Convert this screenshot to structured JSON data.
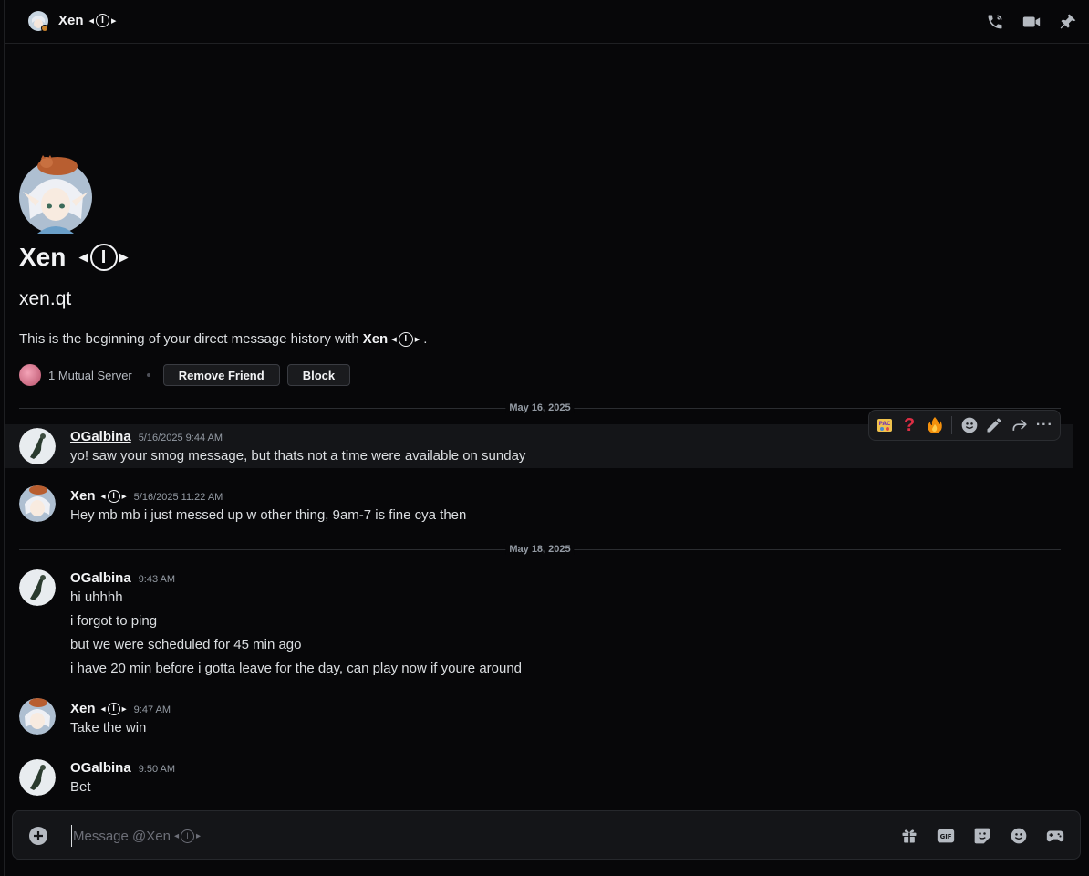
{
  "header": {
    "name": "Xen",
    "icons": [
      "phone-call-icon",
      "video-call-icon",
      "pin-icon"
    ]
  },
  "intro": {
    "display_name": "Xen",
    "username": "xen.qt",
    "description_prefix": "This is the beginning of your direct message history with",
    "description_name": "Xen",
    "description_suffix": ".",
    "mutual_servers": "1 Mutual Server",
    "remove_friend_label": "Remove Friend",
    "block_label": "Block"
  },
  "dividers": [
    "May 16, 2025",
    "May 18, 2025"
  ],
  "messages": [
    {
      "author": "OGalbina",
      "timestamp": "5/16/2025 9:44 AM",
      "lines": [
        "yo! saw your smog message, but thats not a time were available on sunday"
      ]
    },
    {
      "author": "Xen",
      "timestamp": "5/16/2025 11:22 AM",
      "lines": [
        "Hey mb mb i just messed up w other thing, 9am-7 is fine cya then"
      ]
    },
    {
      "author": "OGalbina",
      "timestamp": "9:43 AM",
      "lines": [
        "hi uhhhh",
        "i forgot to ping",
        "but we were scheduled for 45 min ago",
        "i have 20 min before i gotta leave for the day, can play now if youre around"
      ]
    },
    {
      "author": "Xen",
      "timestamp": "9:47 AM",
      "lines": [
        "Take the win"
      ]
    },
    {
      "author": "OGalbina",
      "timestamp": "9:50 AM",
      "lines": [
        "Bet"
      ]
    }
  ],
  "hover_actions": [
    "pac-emoji",
    "question-emoji",
    "fire-emoji",
    "add-reaction-icon",
    "edit-icon",
    "forward-icon",
    "more-icon"
  ],
  "composer": {
    "placeholder": "Message @Xen",
    "icons": [
      "gift-icon",
      "gif-icon",
      "sticker-icon",
      "emoji-icon",
      "activity-icon"
    ]
  },
  "colors": {
    "background": "#070709",
    "highlight": "#141518",
    "text": "#dbdee1",
    "muted": "#949ba4"
  }
}
